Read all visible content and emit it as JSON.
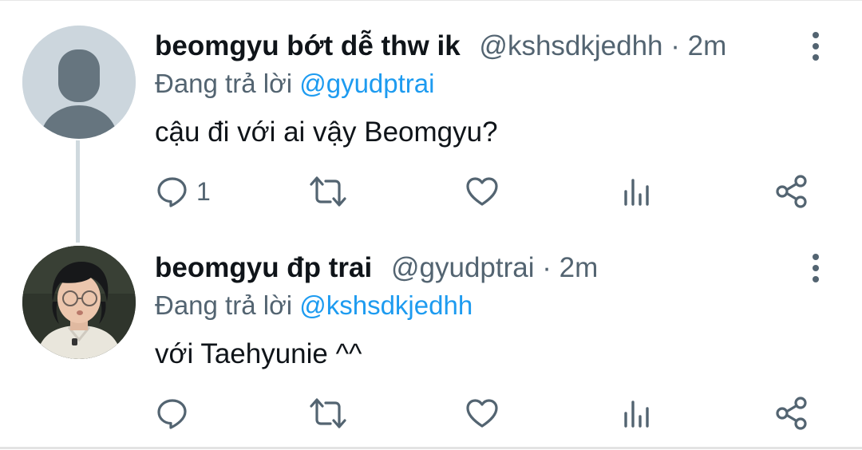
{
  "thread": [
    {
      "display_name": "beomgyu bớt dễ thw ik",
      "handle": "@kshsdkjedhh",
      "separator": "·",
      "time": "2m",
      "replying_to_label": "Đang trả lời",
      "replying_to_handle": "@gyudptrai",
      "text": "cậu đi với ai vậy Beomgyu?",
      "avatar": "default-avatar-icon",
      "stats": {
        "replies": "1"
      }
    },
    {
      "display_name": "beomgyu đp trai",
      "handle": "@gyudptrai",
      "separator": "·",
      "time": "2m",
      "replying_to_label": "Đang trả lời",
      "replying_to_handle": "@kshsdkjedhh",
      "text": "với Taehyunie ^^",
      "avatar": "profile-photo",
      "stats": {
        "replies": ""
      }
    }
  ],
  "colors": {
    "text_primary": "#0f1419",
    "text_secondary": "#536471",
    "link": "#1d9bf0",
    "thread_line": "#cfd9de",
    "default_avatar_bg": "#ccd6dd"
  }
}
